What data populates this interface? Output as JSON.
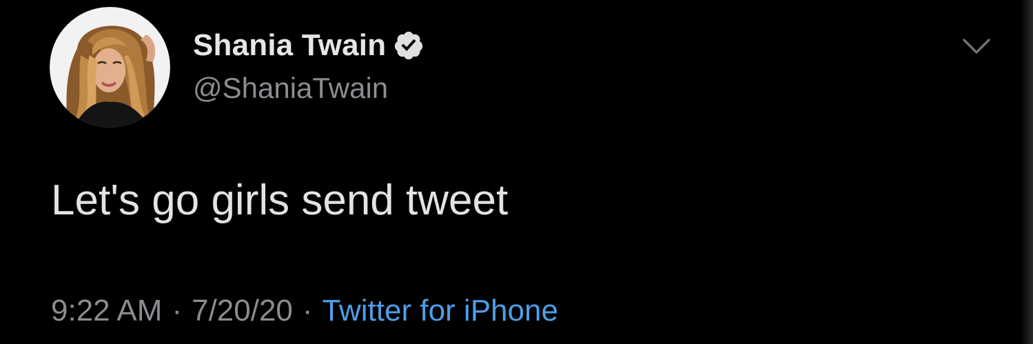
{
  "tweet": {
    "display_name": "Shania Twain",
    "handle": "@ShaniaTwain",
    "text": "Let's go girls send tweet",
    "time": "9:22 AM",
    "date": "7/20/20",
    "separator": "·",
    "source": "Twitter for iPhone"
  },
  "icons": {
    "verified": "verified-badge-icon",
    "menu": "chevron-down-icon"
  },
  "colors": {
    "background": "#000000",
    "name": "#e6e6e6",
    "secondary_text": "#8a8d91",
    "body_text": "#e3e3e3",
    "source_link": "#4e9ee8"
  }
}
